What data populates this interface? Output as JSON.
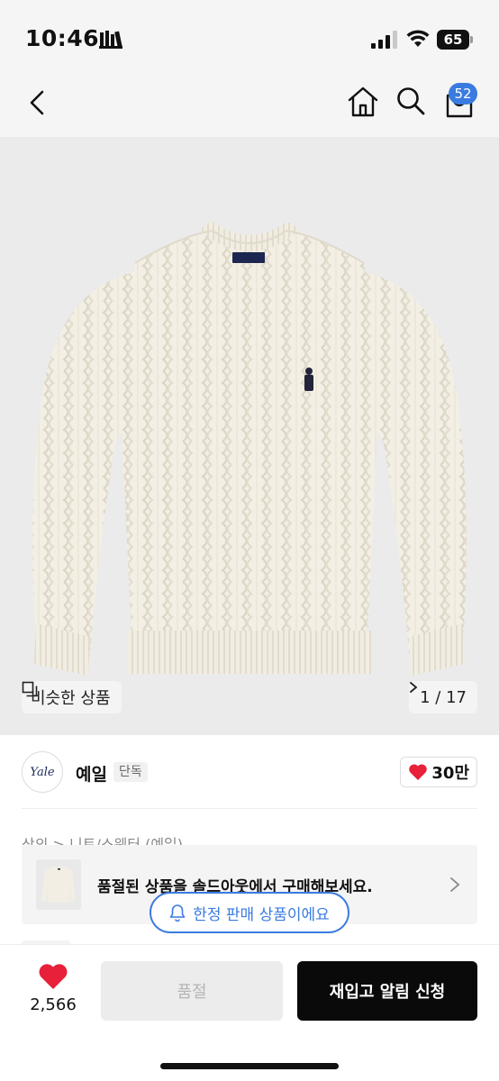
{
  "status_bar": {
    "time": "10:46",
    "battery": "65"
  },
  "nav": {
    "cart_count": "52"
  },
  "colors": {
    "accent": "#3a7be0",
    "like": "#e8203a",
    "primary_button": "#0a0a0a"
  },
  "product_image": {
    "similar_label": "비슷한 상품",
    "page_counter": "1 / 17"
  },
  "brand": {
    "logo_text": "Yale",
    "name": "예일",
    "tag": "단독",
    "likes": "30만"
  },
  "breadcrumb": "상의 > 니트/스웨터 (예일)",
  "soldout_banner": {
    "text": "품절된 상품을 솔드아웃에서 구매해보세요."
  },
  "limited_pill": "한정 판매 상품이에요",
  "bottom_bar": {
    "wish_count": "2,566",
    "soldout_label": "품절",
    "restock_label": "재입고 알림 신청"
  },
  "icons": [
    "focus-icon",
    "signal-icon",
    "wifi-icon",
    "back-icon",
    "home-icon",
    "search-icon",
    "cart-icon",
    "similar-icon",
    "chevron-right-icon",
    "heart-icon",
    "bell-icon"
  ]
}
